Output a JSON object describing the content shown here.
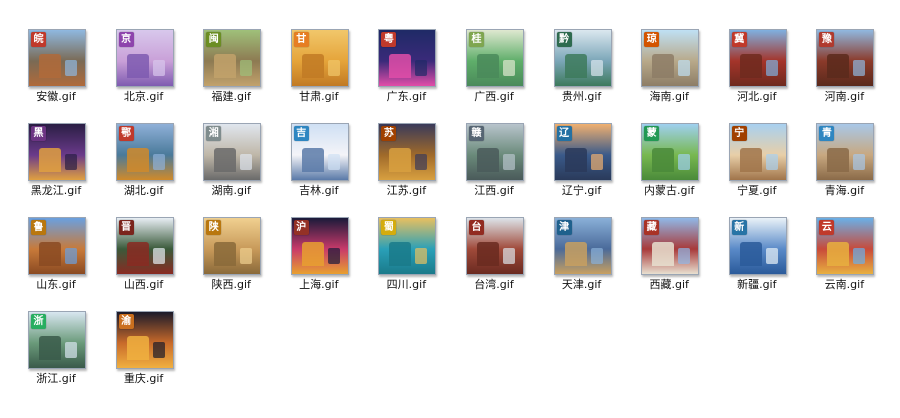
{
  "files": [
    {
      "name": "安徽.gif",
      "badge": "皖",
      "colors": [
        "#8fb8e0",
        "#7a6a55",
        "#b06a3a"
      ],
      "badge_color": "#c0392b"
    },
    {
      "name": "北京.gif",
      "badge": "京",
      "colors": [
        "#d8c8ec",
        "#c9a0d8",
        "#7e5bb0"
      ],
      "badge_color": "#8e44ad"
    },
    {
      "name": "福建.gif",
      "badge": "闽",
      "colors": [
        "#9fc07a",
        "#8d7a52",
        "#c2a26b"
      ],
      "badge_color": "#6b8e23"
    },
    {
      "name": "甘肃.gif",
      "badge": "甘",
      "colors": [
        "#f1c76b",
        "#e5a43a",
        "#c17a25"
      ],
      "badge_color": "#e67e22"
    },
    {
      "name": "广东.gif",
      "badge": "粤",
      "colors": [
        "#1f2a66",
        "#3a2a7a",
        "#e24da8"
      ],
      "badge_color": "#c0392b"
    },
    {
      "name": "广西.gif",
      "badge": "桂",
      "colors": [
        "#dfe8d0",
        "#5fae6a",
        "#4a8a5a"
      ],
      "badge_color": "#7fa650"
    },
    {
      "name": "贵州.gif",
      "badge": "黔",
      "colors": [
        "#dbe7ef",
        "#7ba6b8",
        "#3d7a5c"
      ],
      "badge_color": "#2e6b4f"
    },
    {
      "name": "海南.gif",
      "badge": "琼",
      "colors": [
        "#bfe0f4",
        "#b8a98a",
        "#8d7d66"
      ],
      "badge_color": "#d35400"
    },
    {
      "name": "河北.gif",
      "badge": "冀",
      "colors": [
        "#7fb0e0",
        "#a4342a",
        "#6e2a1e"
      ],
      "badge_color": "#c0392b"
    },
    {
      "name": "河南.gif",
      "badge": "豫",
      "colors": [
        "#90b8e0",
        "#8b3a2a",
        "#5a2a1c"
      ],
      "badge_color": "#b03a2e"
    },
    {
      "name": "黑龙江.gif",
      "badge": "黑",
      "colors": [
        "#2a1e44",
        "#6a3a8a",
        "#e0a040"
      ],
      "badge_color": "#6c3483"
    },
    {
      "name": "湖北.gif",
      "badge": "鄂",
      "colors": [
        "#8fb0d8",
        "#4a7a9a",
        "#d08a2a"
      ],
      "badge_color": "#c0392b"
    },
    {
      "name": "湖南.gif",
      "badge": "湘",
      "colors": [
        "#e0e6ee",
        "#bfb7a8",
        "#6a6a6a"
      ],
      "badge_color": "#7f8c8d"
    },
    {
      "name": "吉林.gif",
      "badge": "吉",
      "colors": [
        "#cfe0f4",
        "#f4f4f8",
        "#5a7aa8"
      ],
      "badge_color": "#2e86c1"
    },
    {
      "name": "江苏.gif",
      "badge": "苏",
      "colors": [
        "#3a3a5a",
        "#a06a2a",
        "#d8a040"
      ],
      "badge_color": "#a04000"
    },
    {
      "name": "江西.gif",
      "badge": "赣",
      "colors": [
        "#b8c4cc",
        "#6a8a7a",
        "#4a5a5a"
      ],
      "badge_color": "#566573"
    },
    {
      "name": "辽宁.gif",
      "badge": "辽",
      "colors": [
        "#f0b070",
        "#3a5a8a",
        "#2a3a5a"
      ],
      "badge_color": "#2471a3"
    },
    {
      "name": "内蒙古.gif",
      "badge": "蒙",
      "colors": [
        "#9fd0f0",
        "#78b850",
        "#4a8a3a"
      ],
      "badge_color": "#229954"
    },
    {
      "name": "宁夏.gif",
      "badge": "宁",
      "colors": [
        "#a8d0f0",
        "#e8cfa8",
        "#a0744a"
      ],
      "badge_color": "#a04000"
    },
    {
      "name": "青海.gif",
      "badge": "青",
      "colors": [
        "#a8c8e8",
        "#c8a880",
        "#8a6a48"
      ],
      "badge_color": "#2e86c1"
    },
    {
      "name": "山东.gif",
      "badge": "鲁",
      "colors": [
        "#6aa0e0",
        "#c87a3a",
        "#8a4a22"
      ],
      "badge_color": "#b9770e"
    },
    {
      "name": "山西.gif",
      "badge": "晋",
      "colors": [
        "#e8eef4",
        "#3a5a3a",
        "#8a2a22"
      ],
      "badge_color": "#7b241c"
    },
    {
      "name": "陕西.gif",
      "badge": "陕",
      "colors": [
        "#f0d090",
        "#c89a5a",
        "#8a6a3a"
      ],
      "badge_color": "#b9770e"
    },
    {
      "name": "上海.gif",
      "badge": "沪",
      "colors": [
        "#1a1a3a",
        "#c83a6a",
        "#e8a030"
      ],
      "badge_color": "#943126"
    },
    {
      "name": "四川.gif",
      "badge": "蜀",
      "colors": [
        "#e8c060",
        "#2aa0b8",
        "#1a7a8a"
      ],
      "badge_color": "#d4ac0d"
    },
    {
      "name": "台湾.gif",
      "badge": "台",
      "colors": [
        "#dde4ea",
        "#a04a3a",
        "#6a2a20"
      ],
      "badge_color": "#922b21"
    },
    {
      "name": "天津.gif",
      "badge": "津",
      "colors": [
        "#8ab0d8",
        "#4a6a9a",
        "#c8a060"
      ],
      "badge_color": "#1f618d"
    },
    {
      "name": "西藏.gif",
      "badge": "藏",
      "colors": [
        "#90b8e8",
        "#a83a3a",
        "#e8e0d0"
      ],
      "badge_color": "#a93226"
    },
    {
      "name": "新疆.gif",
      "badge": "新",
      "colors": [
        "#eaf2f8",
        "#5a8ac8",
        "#2a5a9a"
      ],
      "badge_color": "#2874a6"
    },
    {
      "name": "云南.gif",
      "badge": "云",
      "colors": [
        "#6ab0e8",
        "#c84a3a",
        "#e8b040"
      ],
      "badge_color": "#c0392b"
    },
    {
      "name": "浙江.gif",
      "badge": "浙",
      "colors": [
        "#d8e6f0",
        "#6a9a7a",
        "#3a5a4a"
      ],
      "badge_color": "#27ae60"
    },
    {
      "name": "重庆.gif",
      "badge": "渝",
      "colors": [
        "#1a1a2a",
        "#c86a2a",
        "#f0b040"
      ],
      "badge_color": "#ca6f1e"
    }
  ]
}
